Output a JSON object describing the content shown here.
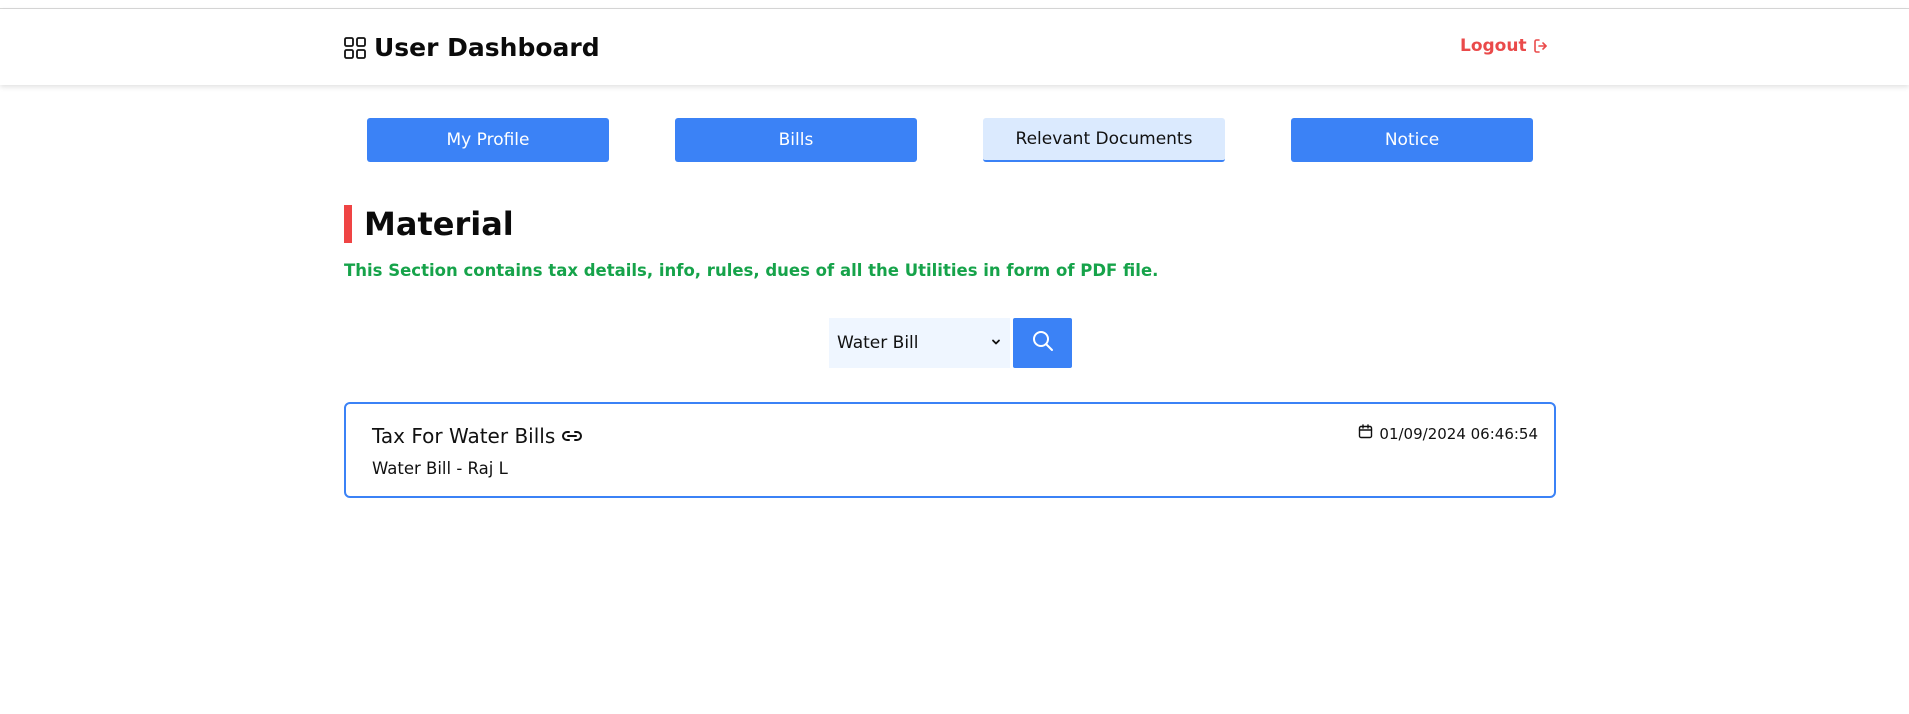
{
  "header": {
    "title": "User Dashboard",
    "brand_icon": "grid-icon",
    "logout_label": "Logout",
    "logout_icon": "logout-icon"
  },
  "tabs": [
    {
      "label": "My Profile",
      "active": false
    },
    {
      "label": "Bills",
      "active": false
    },
    {
      "label": "Relevant Documents",
      "active": true
    },
    {
      "label": "Notice",
      "active": false
    }
  ],
  "section": {
    "heading": "Material",
    "description": "This Section contains tax details, info, rules, dues of all the Utilities in form of PDF file."
  },
  "filter": {
    "selected": "Water Bill",
    "search_icon": "search-icon"
  },
  "documents": [
    {
      "title": "Tax For Water Bills",
      "subtitle": "Water Bill - Raj L",
      "date": "01/09/2024 06:46:54",
      "link_icon": "link-icon",
      "date_icon": "calendar-icon"
    }
  ],
  "colors": {
    "primary": "#3b82f6",
    "active_tab_bg": "#dbeafe",
    "accent_red": "#ef4444",
    "logout_red": "#ea4a4a",
    "description_green": "#16a34a",
    "select_bg": "#eff6ff"
  }
}
